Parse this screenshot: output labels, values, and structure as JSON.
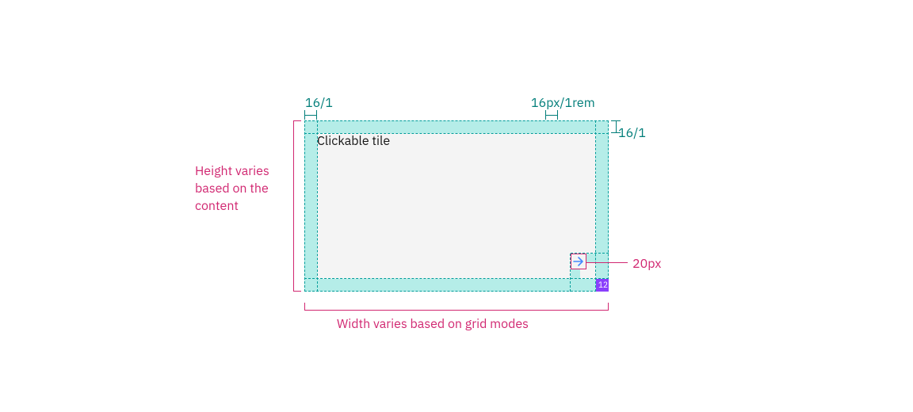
{
  "tile": {
    "label": "Clickable tile"
  },
  "spec": {
    "pad_tl": "16/1",
    "pad_tr": "16px/1rem",
    "pad_r": "16/1",
    "icon_size": "20px",
    "corner_gap": "12"
  },
  "notes": {
    "height": "Height varies based on the content",
    "width": "Width varies based on grid modes"
  }
}
